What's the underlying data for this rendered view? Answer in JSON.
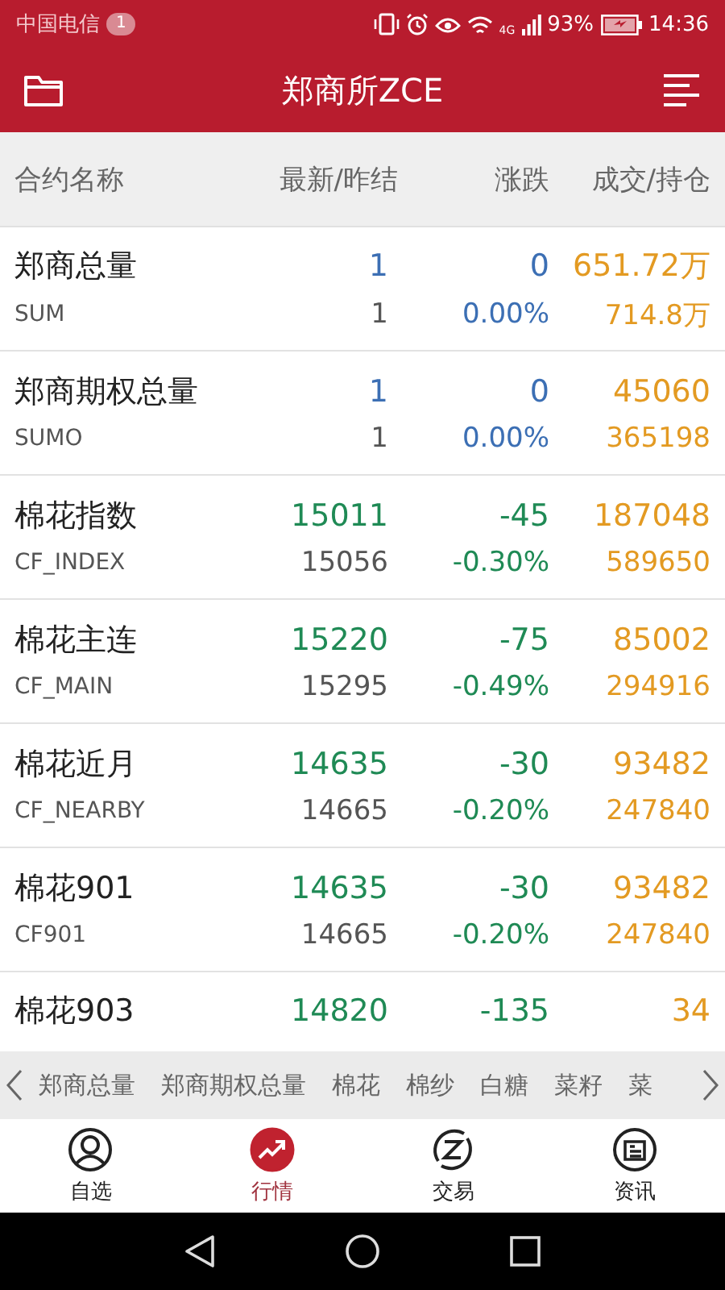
{
  "status_bar": {
    "carrier": "中国电信",
    "notification_count": "1",
    "network": "4G",
    "battery": "93%",
    "time": "14:36"
  },
  "header": {
    "title": "郑商所ZCE"
  },
  "table": {
    "columns": [
      "合约名称",
      "最新/昨结",
      "涨跌",
      "成交/持仓"
    ],
    "rows": [
      {
        "name": "郑商总量",
        "code": "SUM",
        "latest": "1",
        "prev": "1",
        "change": "0",
        "pct": "0.00%",
        "volume": "651.72万",
        "open_interest": "714.8万",
        "kind": "flat"
      },
      {
        "name": "郑商期权总量",
        "code": "SUMO",
        "latest": "1",
        "prev": "1",
        "change": "0",
        "pct": "0.00%",
        "volume": "45060",
        "open_interest": "365198",
        "kind": "flat"
      },
      {
        "name": "棉花指数",
        "code": "CF_INDEX",
        "latest": "15011",
        "prev": "15056",
        "change": "-45",
        "pct": "-0.30%",
        "volume": "187048",
        "open_interest": "589650",
        "kind": "down"
      },
      {
        "name": "棉花主连",
        "code": "CF_MAIN",
        "latest": "15220",
        "prev": "15295",
        "change": "-75",
        "pct": "-0.49%",
        "volume": "85002",
        "open_interest": "294916",
        "kind": "down"
      },
      {
        "name": "棉花近月",
        "code": "CF_NEARBY",
        "latest": "14635",
        "prev": "14665",
        "change": "-30",
        "pct": "-0.20%",
        "volume": "93482",
        "open_interest": "247840",
        "kind": "down"
      },
      {
        "name": "棉花901",
        "code": "CF901",
        "latest": "14635",
        "prev": "14665",
        "change": "-30",
        "pct": "-0.20%",
        "volume": "93482",
        "open_interest": "247840",
        "kind": "down"
      },
      {
        "name": "棉花903",
        "latest": "14820",
        "change": "-135",
        "volume": "34",
        "kind": "down"
      }
    ]
  },
  "categories": [
    {
      "label": "郑商总量",
      "selected": false
    },
    {
      "label": "郑商期权总量",
      "selected": false
    },
    {
      "label": "棉花",
      "selected": false
    },
    {
      "label": "棉纱",
      "selected": false
    },
    {
      "label": "白糖",
      "selected": false
    },
    {
      "label": "菜籽",
      "selected": false
    },
    {
      "label": "菜",
      "selected": false
    }
  ],
  "bottom_nav": [
    {
      "label": "自选",
      "kind": "person",
      "selected": false
    },
    {
      "label": "行情",
      "kind": "trend",
      "selected": true
    },
    {
      "label": "交易",
      "kind": "exchange",
      "selected": false
    },
    {
      "label": "资讯",
      "kind": "news",
      "selected": false
    }
  ]
}
